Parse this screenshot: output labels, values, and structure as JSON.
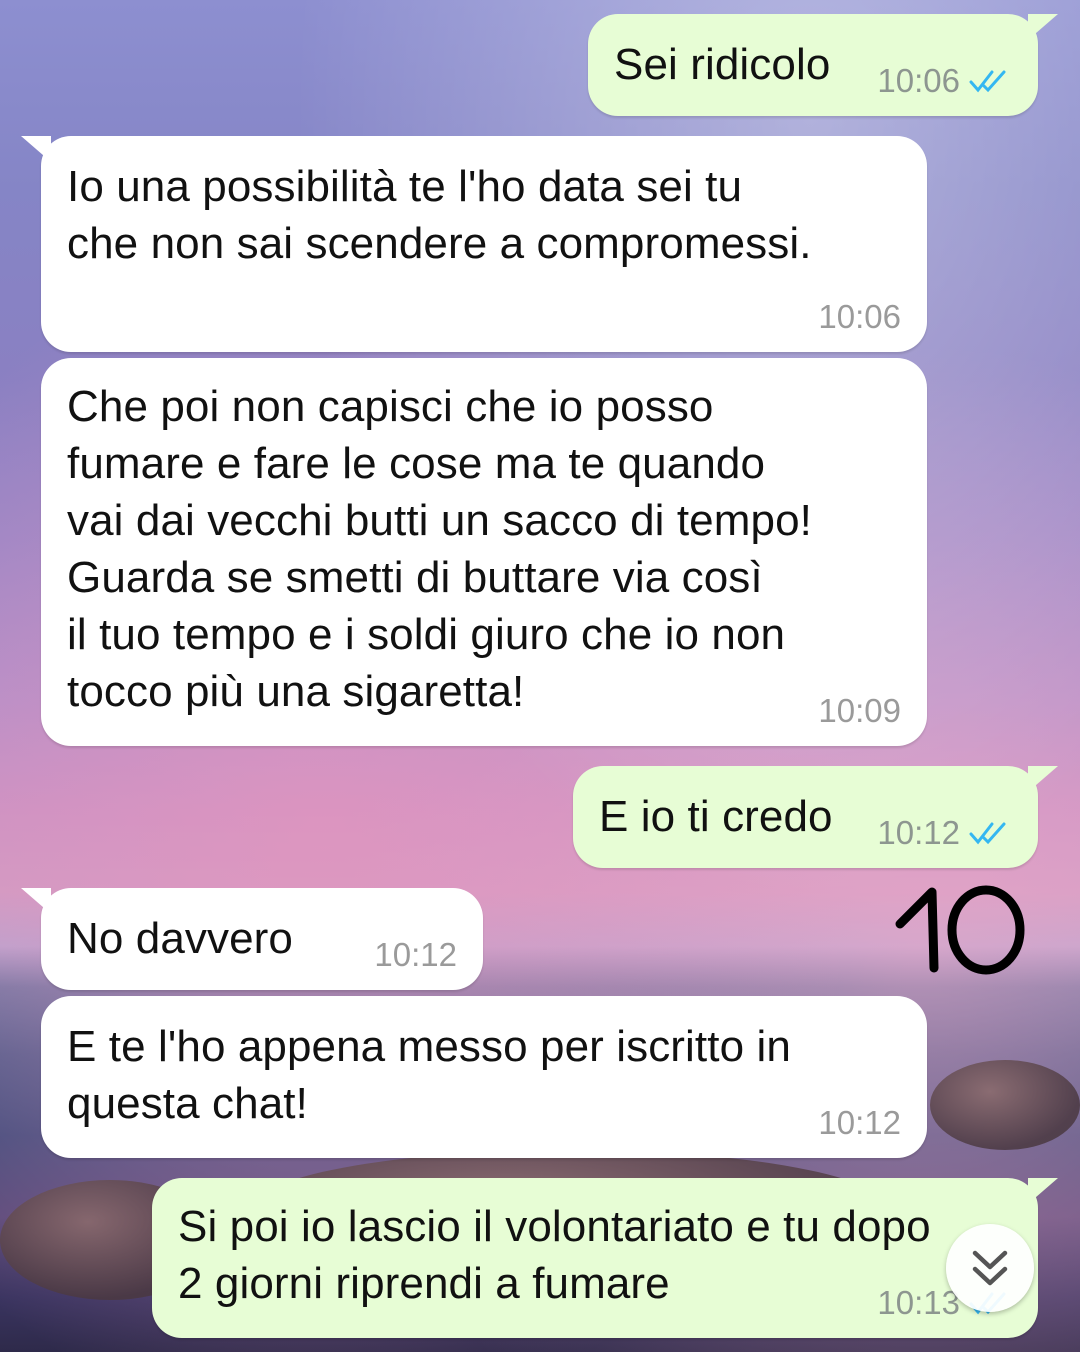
{
  "messages": [
    {
      "direction": "out",
      "text": "Sei ridicolo",
      "time": "10:06",
      "status": "read"
    },
    {
      "direction": "in",
      "text": "Io una possibilità te l'ho data sei tu\nche non sai scendere a compromessi.",
      "time": "10:06"
    },
    {
      "direction": "in",
      "text": "Che poi non capisci che io posso\nfumare e fare le cose ma te quando\nvai dai vecchi butti un sacco di tempo!\nGuarda se smetti di buttare via così\nil tuo tempo e i soldi giuro che io non\ntocco più una sigaretta!",
      "time": "10:09"
    },
    {
      "direction": "out",
      "text": "E io ti credo",
      "time": "10:12",
      "status": "read"
    },
    {
      "direction": "in",
      "text": "No davvero",
      "time": "10:12"
    },
    {
      "direction": "in",
      "text": "E te l'ho appena messo per iscritto in\nquesta chat!",
      "time": "10:12"
    },
    {
      "direction": "out",
      "text": "Si poi io lascio il volontariato e tu dopo\n2 giorni riprendi a fumare",
      "time": "10:13",
      "status": "read"
    }
  ],
  "annotation": {
    "text": "10",
    "style": "handwritten"
  },
  "icons": {
    "read_receipt": "double-check-icon",
    "scroll": "chevron-double-down-icon"
  },
  "colors": {
    "incoming_bubble": "#ffffff",
    "outgoing_bubble": "#e7fdd5",
    "read_tick": "#34b7f1",
    "timestamp": "#8d9690"
  }
}
